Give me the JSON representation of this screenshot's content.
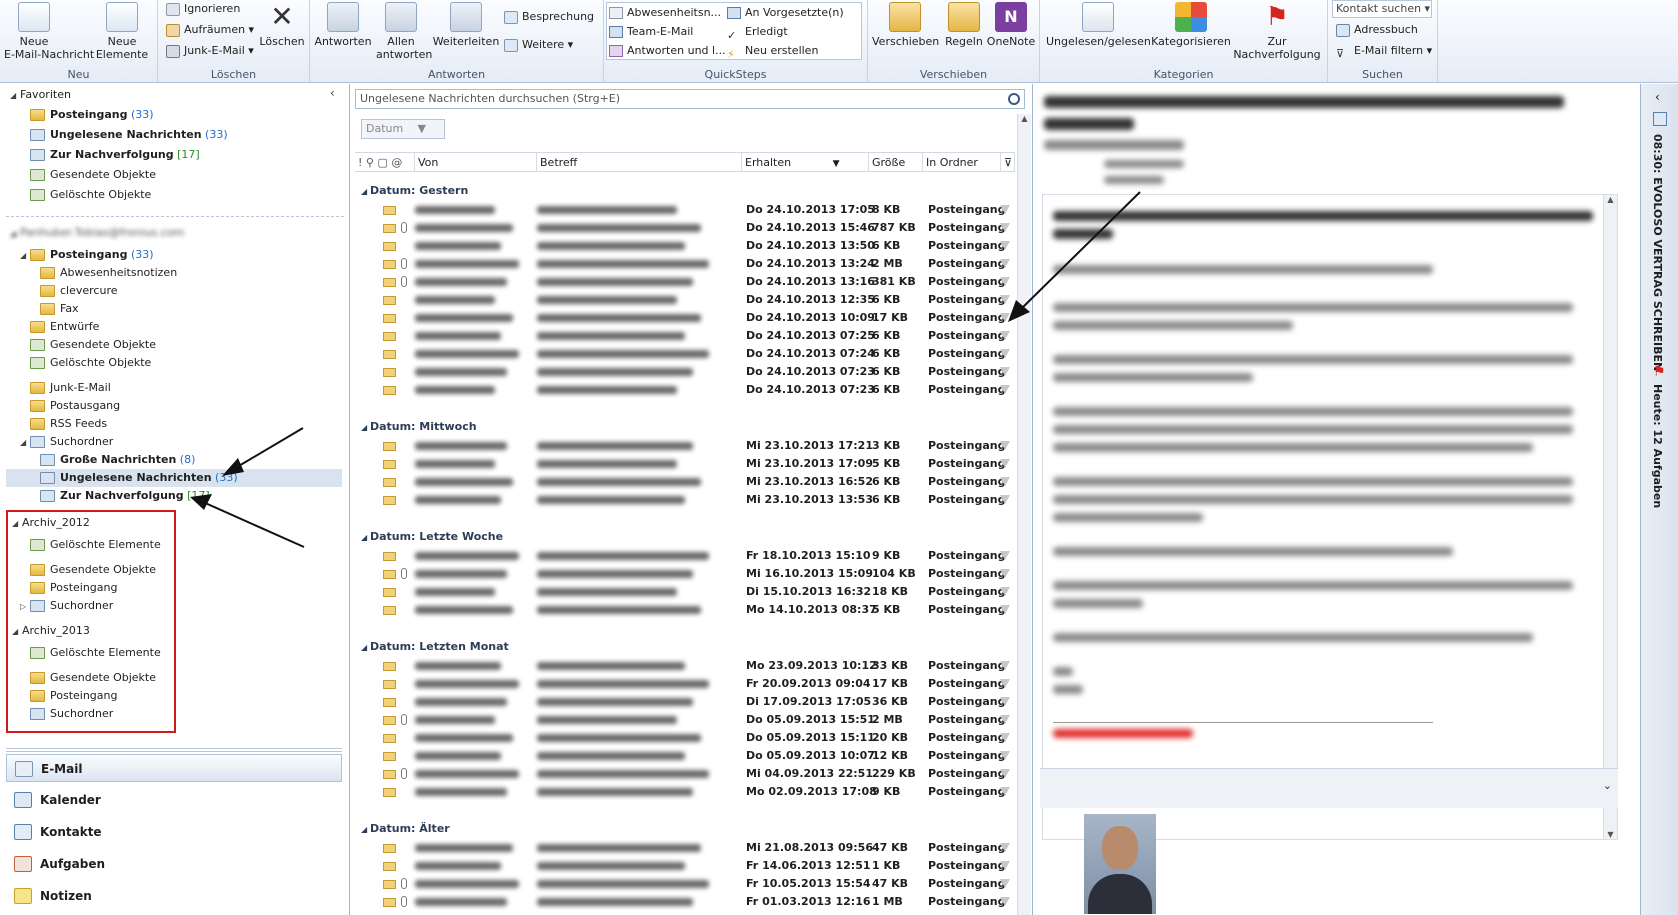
{
  "ribbon": {
    "new_email": "Neue\nE-Mail-Nachricht",
    "new_items": "Neue\nElemente",
    "group_new": "Neu",
    "ignore": "Ignorieren",
    "cleanup": "Aufräumen",
    "junk": "Junk-E-Mail",
    "delete": "Löschen",
    "group_delete": "Löschen",
    "reply": "Antworten",
    "reply_all": "Allen\nantworten",
    "forward": "Weiterleiten",
    "meeting": "Besprechung",
    "more": "Weitere",
    "group_respond": "Antworten",
    "qs": [
      "Abwesenheitsn...",
      "An Vorgesetzte(n)",
      "Team-E-Mail",
      "Erledigt",
      "Antworten und l...",
      "Neu erstellen"
    ],
    "group_qs": "QuickSteps",
    "move": "Verschieben",
    "rules": "Regeln",
    "onenote": "OneNote",
    "group_move": "Verschieben",
    "unread_read": "Ungelesen/gelesen",
    "categorize": "Kategorisieren",
    "followup": "Zur\nNachverfolgung",
    "group_tags": "Kategorien",
    "contact_search": "Kontakt suchen",
    "address_book": "Adressbuch",
    "filter_email": "E-Mail filtern",
    "group_find": "Suchen"
  },
  "nav": {
    "favorites": "Favoriten",
    "fav_items": [
      {
        "label": "Posteingang",
        "count": "(33)"
      },
      {
        "label": "Ungelesene Nachrichten",
        "count": "(33)"
      },
      {
        "label": "Zur Nachverfolgung",
        "count": "[17]"
      },
      {
        "label": "Gesendete Objekte",
        "count": ""
      },
      {
        "label": "Gelöschte Objekte",
        "count": ""
      }
    ],
    "mailbox": "Panhuber.Tobias@fronius.com",
    "inbox": {
      "label": "Posteingang",
      "count": "(33)"
    },
    "inbox_sub": [
      "Abwesenheitsnotizen",
      "clevercure",
      "Fax"
    ],
    "folders1": [
      "Entwürfe",
      "Gesendete Objekte",
      "Gelöschte Objekte"
    ],
    "folders2": [
      "Junk-E-Mail",
      "Postausgang",
      "RSS Feeds"
    ],
    "search_folders": "Suchordner",
    "search_items": [
      {
        "label": "Große Nachrichten",
        "count": "(8)"
      },
      {
        "label": "Ungelesene Nachrichten",
        "count": "(33)"
      },
      {
        "label": "Zur Nachverfolgung",
        "count": "[17]"
      }
    ],
    "archive_2012": "Archiv_2012",
    "archive_2012_items": [
      "Gelöschte Elemente",
      "Gesendete Objekte",
      "Posteingang",
      "Suchordner"
    ],
    "archive_2013": "Archiv_2013",
    "archive_2013_items": [
      "Gelöschte Elemente",
      "Gesendete Objekte",
      "Posteingang",
      "Suchordner"
    ],
    "modules": [
      "E-Mail",
      "Kalender",
      "Kontakte",
      "Aufgaben",
      "Notizen"
    ]
  },
  "list": {
    "search_placeholder": "Ungelesene Nachrichten durchsuchen (Strg+E)",
    "sort": "Datum",
    "columns": {
      "from": "Von",
      "subject": "Betreff",
      "received": "Erhalten",
      "size": "Größe",
      "folder": "In Ordner"
    },
    "groups": [
      {
        "title": "Datum: Gestern",
        "rows": [
          {
            "date": "Do 24.10.2013 17:05",
            "size": "8 KB",
            "folder": "Posteingang"
          },
          {
            "date": "Do 24.10.2013 15:46",
            "size": "787 KB",
            "folder": "Posteingang",
            "clip": true
          },
          {
            "date": "Do 24.10.2013 13:50",
            "size": "6 KB",
            "folder": "Posteingang"
          },
          {
            "date": "Do 24.10.2013 13:24",
            "size": "2 MB",
            "folder": "Posteingang",
            "clip": true
          },
          {
            "date": "Do 24.10.2013 13:16",
            "size": "381 KB",
            "folder": "Posteingang",
            "clip": true
          },
          {
            "date": "Do 24.10.2013 12:35",
            "size": "6 KB",
            "folder": "Posteingang"
          },
          {
            "date": "Do 24.10.2013 10:09",
            "size": "17 KB",
            "folder": "Posteingang"
          },
          {
            "date": "Do 24.10.2013 07:25",
            "size": "6 KB",
            "folder": "Posteingang"
          },
          {
            "date": "Do 24.10.2013 07:24",
            "size": "6 KB",
            "folder": "Posteingang"
          },
          {
            "date": "Do 24.10.2013 07:23",
            "size": "6 KB",
            "folder": "Posteingang"
          },
          {
            "date": "Do 24.10.2013 07:23",
            "size": "6 KB",
            "folder": "Posteingang"
          }
        ]
      },
      {
        "title": "Datum: Mittwoch",
        "rows": [
          {
            "date": "Mi 23.10.2013 17:21",
            "size": "3 KB",
            "folder": "Posteingang"
          },
          {
            "date": "Mi 23.10.2013 17:09",
            "size": "5 KB",
            "folder": "Posteingang"
          },
          {
            "date": "Mi 23.10.2013 16:52",
            "size": "6 KB",
            "folder": "Posteingang"
          },
          {
            "date": "Mi 23.10.2013 13:53",
            "size": "6 KB",
            "folder": "Posteingang"
          }
        ]
      },
      {
        "title": "Datum: Letzte Woche",
        "rows": [
          {
            "date": "Fr 18.10.2013 15:10",
            "size": "9 KB",
            "folder": "Posteingang"
          },
          {
            "date": "Mi 16.10.2013 15:09",
            "size": "104 KB",
            "folder": "Posteingang",
            "clip": true
          },
          {
            "date": "Di 15.10.2013 16:32",
            "size": "18 KB",
            "folder": "Posteingang"
          },
          {
            "date": "Mo 14.10.2013 08:37",
            "size": "5 KB",
            "folder": "Posteingang"
          }
        ]
      },
      {
        "title": "Datum: Letzten Monat",
        "rows": [
          {
            "date": "Mo 23.09.2013 10:12",
            "size": "33 KB",
            "folder": "Posteingang"
          },
          {
            "date": "Fr 20.09.2013 09:04",
            "size": "17 KB",
            "folder": "Posteingang"
          },
          {
            "date": "Di 17.09.2013 17:05",
            "size": "36 KB",
            "folder": "Posteingang"
          },
          {
            "date": "Do 05.09.2013 15:51",
            "size": "2 MB",
            "folder": "Posteingang",
            "clip": true
          },
          {
            "date": "Do 05.09.2013 15:11",
            "size": "20 KB",
            "folder": "Posteingang"
          },
          {
            "date": "Do 05.09.2013 10:07",
            "size": "12 KB",
            "folder": "Posteingang"
          },
          {
            "date": "Mi 04.09.2013 22:51",
            "size": "229 KB",
            "folder": "Posteingang",
            "clip": true
          },
          {
            "date": "Mo 02.09.2013 17:08",
            "size": "9 KB",
            "folder": "Posteingang"
          }
        ]
      },
      {
        "title": "Datum: Älter",
        "rows": [
          {
            "date": "Mi 21.08.2013 09:56",
            "size": "47 KB",
            "folder": "Posteingang"
          },
          {
            "date": "Fr 14.06.2013 12:51",
            "size": "1 KB",
            "folder": "Posteingang"
          },
          {
            "date": "Fr 10.05.2013 15:54",
            "size": "47 KB",
            "folder": "Posteingang",
            "clip": true
          },
          {
            "date": "Fr 01.03.2013 12:16",
            "size": "1 MB",
            "folder": "Posteingang",
            "clip": true
          }
        ]
      }
    ]
  },
  "todo": {
    "appointment": "08:30: EVOLOSO VERTRAG SCHREIBEN",
    "tasks": "Heute: 12 Aufgaben"
  }
}
